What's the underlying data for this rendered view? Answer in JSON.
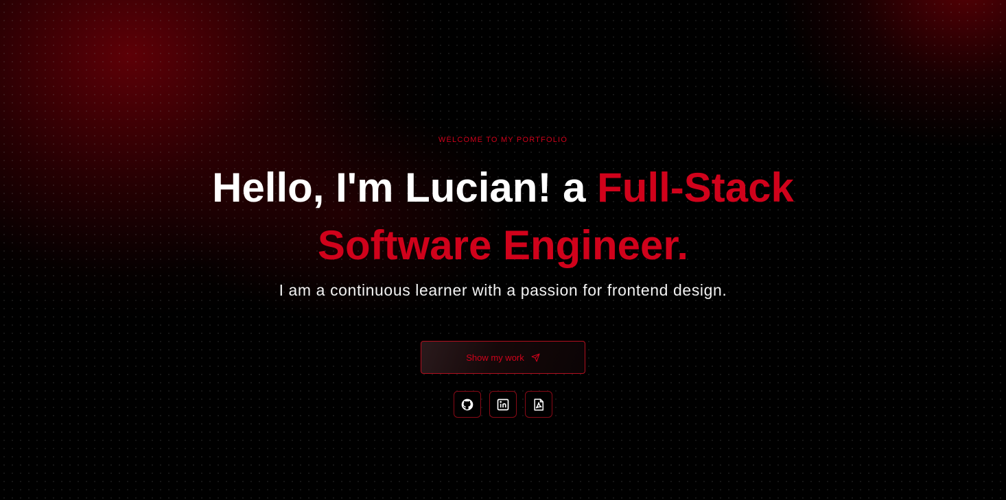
{
  "hero": {
    "eyebrow": "WELCOME TO MY PORTFOLIO",
    "headline_line1_white": "Hello, I'm Lucian! a ",
    "headline_line1_accent": "Full-Stack",
    "headline_line2_accent": "Software Engineer.",
    "subtitle": "I am a continuous learner with a passion for frontend design."
  },
  "cta": {
    "label": "Show my work",
    "icon": "send-icon"
  },
  "socials": [
    {
      "icon": "github-icon"
    },
    {
      "icon": "linkedin-icon"
    },
    {
      "icon": "pdf-icon"
    }
  ],
  "colors": {
    "background": "#000000",
    "accent": "#d0021b",
    "text": "#ffffff",
    "border": "#b3101f"
  }
}
